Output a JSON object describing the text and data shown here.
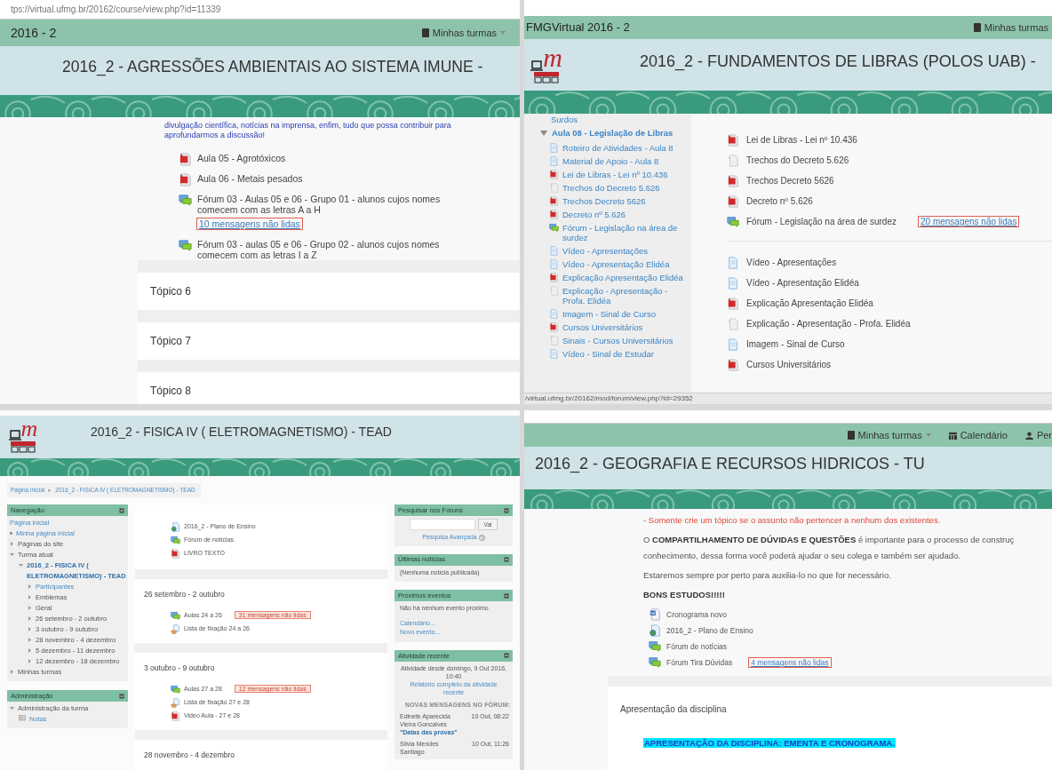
{
  "top_left": {
    "url": "tps://virtual.ufmg.br/20162/course/view.php?id=11339",
    "site_title": "2016 - 2",
    "nav_links": [
      {
        "label": "Minhas turmas",
        "dropdown": true
      }
    ],
    "course_title": "2016_2 - AGRESSÕES AMBIENTAIS AO SISTEMA IMUNE -",
    "intro": "divulgação científica, notícias na imprensa, enfim, tudo que possa contribuir para aprofundarmos a discussão!",
    "activities": [
      {
        "kind": "pdf",
        "label": "Aula 05 - Agrotóxicos"
      },
      {
        "kind": "pdf",
        "label": "Aula 06 - Metais pesados"
      },
      {
        "kind": "forum",
        "label": "Fórum 03 - Aulas 05 e 06 - Grupo 01 - alunos cujos nomes comecem com as letras A a H",
        "unread": "10 mensagens não lidas"
      },
      {
        "kind": "forum",
        "label": "Fórum 03 - aulas 05 e 06 - Grupo 02 - alunos cujos nomes comecem com as letras I a Z"
      }
    ],
    "sections": [
      "Tópico 6",
      "Tópico 7",
      "Tópico 8"
    ]
  },
  "top_right": {
    "site_title": "FMGVirtual 2016 - 2",
    "nav_links": [
      {
        "label": "Minhas turmas",
        "dropdown": false
      }
    ],
    "logo_letter": "m",
    "course_title": "2016_2 - FUNDAMENTOS DE LIBRAS (POLOS UAB) -",
    "sidebar": {
      "previous": "Surdos",
      "section": {
        "label": "Aula 08 - Legislação de Libras",
        "expanded": true,
        "children": [
          {
            "kind": "file",
            "label": "Roteiro de Atividades - Aula 8"
          },
          {
            "kind": "file",
            "label": "Material de Apoio - Aula 8"
          },
          {
            "kind": "pdf",
            "label": "Lei de Libras - Lei nº 10.436"
          },
          {
            "kind": "generic",
            "label": "Trechos do Decreto 5.626"
          },
          {
            "kind": "pdf",
            "label": "Trechos Decreto 5626"
          },
          {
            "kind": "pdf",
            "label": "Decreto nº 5.626"
          },
          {
            "kind": "forum",
            "label": "Fórum - Legislação na área de surdez"
          },
          {
            "kind": "file",
            "label": "Vídeo - Apresentações"
          },
          {
            "kind": "file",
            "label": "Vídeo - Apresentação Elidéa"
          },
          {
            "kind": "pdf",
            "label": "Explicação Apresentação Elidéa"
          },
          {
            "kind": "generic",
            "label": "Explicação - Apresentação - Profa. Elidéa"
          },
          {
            "kind": "file",
            "label": "Imagem - Sinal de Curso"
          },
          {
            "kind": "pdf",
            "label": "Cursos Universitários"
          },
          {
            "kind": "generic",
            "label": "Sinais - Cursos Universitários"
          },
          {
            "kind": "file",
            "label": "Vídeo - Sinal de Estudar"
          }
        ]
      }
    },
    "groups": [
      [
        {
          "kind": "pdf",
          "label": "Lei de Libras - Lei nº 10.436"
        },
        {
          "kind": "generic",
          "label": "Trechos do Decreto 5.626"
        },
        {
          "kind": "pdf",
          "label": "Trechos Decreto 5626"
        },
        {
          "kind": "pdf",
          "label": "Decreto nº 5.626"
        },
        {
          "kind": "forum",
          "label": "Fórum - Legislação na área de surdez",
          "unread": "20 mensagens não lidas"
        }
      ],
      [
        {
          "kind": "file",
          "label": "Vídeo - Apresentações"
        },
        {
          "kind": "file",
          "label": "Vídeo - Apresentação Elidéa"
        },
        {
          "kind": "pdf",
          "label": "Explicação Apresentação Elidéa"
        },
        {
          "kind": "generic",
          "label": "Explicação - Apresentação - Profa. Elidéa"
        },
        {
          "kind": "file",
          "label": "Imagem - Sinal de Curso"
        },
        {
          "kind": "pdf",
          "label": "Cursos Universitários"
        }
      ]
    ],
    "status_url": "/virtual.ufmg.br/20162/mod/forum/view.php?id=29352"
  },
  "bottom_left": {
    "logo_letter": "m",
    "course_title": "2016_2 - FISICA IV ( ELETROMAGNETISMO) - TEAD",
    "breadcrumb": [
      "Página inicial",
      "2016_2 - FISICA IV ( ELETROMAGNETISMO) - TEAD"
    ],
    "breadcrumb_separator": "▸",
    "navigation": {
      "title": "Navegação",
      "items": [
        {
          "kind": "home",
          "label": "Página inicial"
        },
        {
          "kind": "bullet",
          "label": "Minha página inicial"
        },
        {
          "kind": "branch",
          "label": "Páginas do site",
          "expanded": false
        },
        {
          "kind": "branch",
          "label": "Turma atual",
          "expanded": true,
          "children": [
            {
              "kind": "course",
              "label": "2016_2 - FISICA IV ( ELETROMAGNETISMO) - TEAD",
              "expanded": true,
              "children": [
                {
                  "kind": "link_branch",
                  "label": "Participantes",
                  "expanded": false
                },
                {
                  "kind": "branch",
                  "label": "Emblemas",
                  "expanded": false
                },
                {
                  "kind": "branch",
                  "label": "Geral",
                  "expanded": false
                },
                {
                  "kind": "branch",
                  "label": "26 setembro - 2 outubro",
                  "expanded": false
                },
                {
                  "kind": "branch",
                  "label": "3 outubro - 9 outubro",
                  "expanded": false
                },
                {
                  "kind": "branch",
                  "label": "28 novembro - 4 dezembro",
                  "expanded": false
                },
                {
                  "kind": "branch",
                  "label": "5 dezembro - 11 dezembro",
                  "expanded": false
                },
                {
                  "kind": "branch",
                  "label": "12 dezembro - 18 dezembro",
                  "expanded": false
                }
              ]
            }
          ]
        },
        {
          "kind": "branch",
          "label": "Minhas turmas",
          "expanded": false
        }
      ]
    },
    "administration": {
      "title": "Administração",
      "items": [
        {
          "kind": "branch",
          "label": "Administração da turma",
          "expanded": true,
          "children": [
            {
              "kind": "grades",
              "label": "Notas"
            }
          ]
        }
      ]
    },
    "top_activities": [
      {
        "kind": "page",
        "label": "2016_2 - Plano de Ensino"
      },
      {
        "kind": "forum",
        "label": "Fórum de notícias"
      },
      {
        "kind": "pdf",
        "label": "LIVRO TEXTO"
      }
    ],
    "sections": [
      {
        "title": "26 setembro - 2 outubro",
        "activities": [
          {
            "kind": "forum",
            "label": "Aulas 24 a 26",
            "unread": "31 mensagens não lidas"
          },
          {
            "kind": "quiz",
            "label": "Lista de fixação 24 a 26"
          }
        ]
      },
      {
        "title": "3 outubro - 9 outubro",
        "activities": [
          {
            "kind": "forum",
            "label": "Aulas 27 a 28",
            "unread": "12 mensagens não lidas"
          },
          {
            "kind": "quiz",
            "label": "Lista de fixação 27 e 28"
          },
          {
            "kind": "pdf",
            "label": "Video Aula - 27 e 28"
          }
        ]
      },
      {
        "title": "28 novembro - 4 dezembro"
      }
    ],
    "search_block": {
      "title": "Pesquisar nos Fóruns",
      "button": "Vai",
      "advanced": "Pesquisa Avançada"
    },
    "news_block": {
      "title": "Últimas notícias",
      "text": "(Nenhuma notícia publicada)"
    },
    "events_block": {
      "title": "Próximos eventos",
      "text": "Não há nenhum evento próximo",
      "links": [
        "Calendário...",
        "Novo evento..."
      ]
    },
    "recent_block": {
      "title": "Atividade recente",
      "since": "Atividade desde domingo, 9 Out 2016, 10:40",
      "report": "Relatório completo da atividade recente",
      "heading": "NOVAS MENSAGENS NO FÓRUM:",
      "posts": [
        {
          "author": "Edinete Aparecida Vieira Goncalves",
          "date": "10 Out, 08:22",
          "subject": "\"Datas das provas\""
        },
        {
          "author": "Silvia Mendes Santiago",
          "date": "10 Out, 11:26"
        }
      ]
    }
  },
  "bottom_right": {
    "nav_links": [
      {
        "label": "Minhas turmas",
        "dropdown": true,
        "kind": "courses"
      },
      {
        "label": "Calendário",
        "dropdown": false,
        "kind": "calendar"
      },
      {
        "label": "Per",
        "dropdown": false,
        "kind": "user"
      }
    ],
    "course_title": "2016_2 - GEOGRAFIA E RECURSOS HIDRICOS - TU",
    "note": "- Somente crie um tópico se o assunto não pertencer a nenhum dos existentes.",
    "paragraph_lines": [
      "O **COMPARTILHAMENTO DE DÚVIDAS E QUESTÕES** é importante para o processo de construç",
      "conhecimento, dessa forma você poderá ajudar o seu colega e também ser ajudado."
    ],
    "support": "Estaremos sempre por perto para auxilia-lo no que for necessário.",
    "closing": "BONS ESTUDOS!!!!!",
    "activities": [
      {
        "kind": "word",
        "label": "Cronograma novo"
      },
      {
        "kind": "page",
        "label": "2016_2 - Plano de Ensino"
      },
      {
        "kind": "forum",
        "label": "Fórum de notícias"
      },
      {
        "kind": "forum",
        "label": "Fórum Tira Dúvidas",
        "unread": "4 mensagens não lidas"
      }
    ],
    "section_title": "Apresentação da disciplina",
    "highlight": "APRESENTAÇÃO DA DISCIPLINA: EMENTA E CRONOGRAMA."
  }
}
